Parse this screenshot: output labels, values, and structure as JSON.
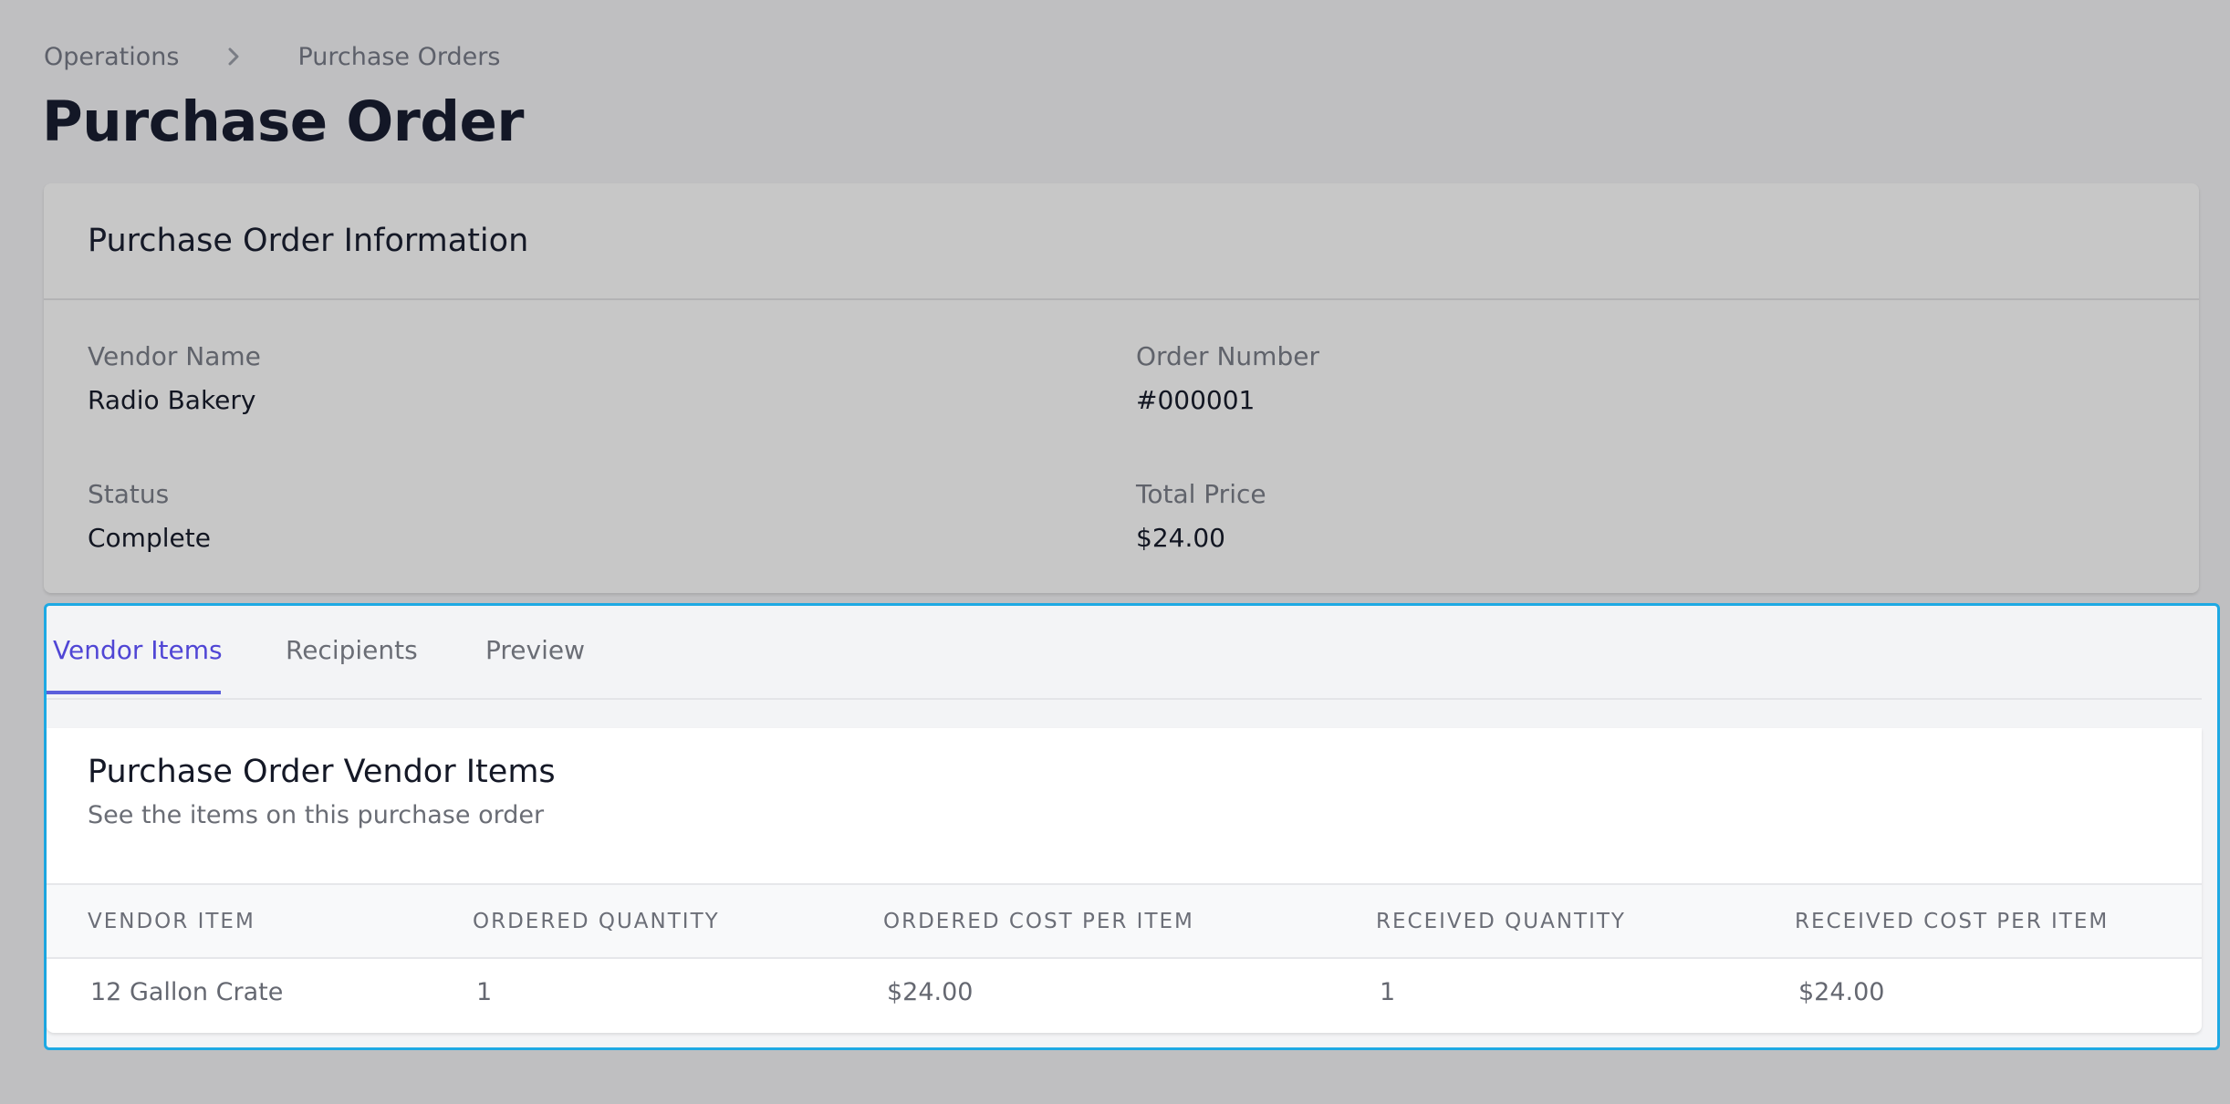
{
  "breadcrumb": {
    "parent": "Operations",
    "current": "Purchase Orders"
  },
  "page": {
    "title": "Purchase Order"
  },
  "info_card": {
    "title": "Purchase Order Information",
    "fields": {
      "vendor_name": {
        "label": "Vendor Name",
        "value": "Radio Bakery"
      },
      "order_number": {
        "label": "Order Number",
        "value": "#000001"
      },
      "status": {
        "label": "Status",
        "value": "Complete"
      },
      "total_price": {
        "label": "Total Price",
        "value": "$24.00"
      }
    }
  },
  "tabs": [
    {
      "label": "Vendor Items",
      "active": true
    },
    {
      "label": "Recipients",
      "active": false
    },
    {
      "label": "Preview",
      "active": false
    }
  ],
  "vendor_items": {
    "title": "Purchase Order Vendor Items",
    "subtitle": "See the items on this purchase order",
    "columns": [
      "VENDOR ITEM",
      "ORDERED QUANTITY",
      "ORDERED COST PER ITEM",
      "RECEIVED QUANTITY",
      "RECEIVED COST PER ITEM"
    ],
    "rows": [
      [
        "12 Gallon Crate",
        "1",
        "$24.00",
        "1",
        "$24.00"
      ]
    ]
  },
  "colors": {
    "background": "#bfbfc1",
    "accent": "#5046d5",
    "focus_outline": "#1ea9e3"
  },
  "icons": {
    "breadcrumb_separator": "chevron-right-icon"
  }
}
